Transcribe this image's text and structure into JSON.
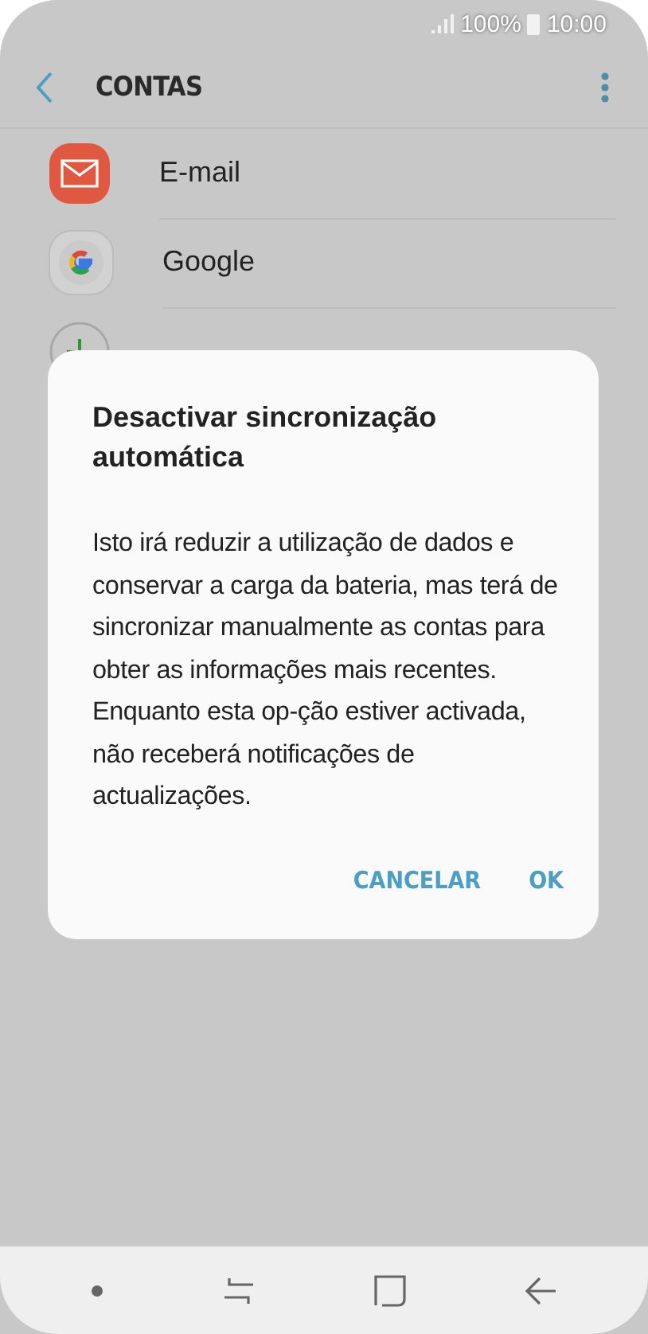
{
  "status_bar": {
    "battery": "100%",
    "time": "10:00"
  },
  "header": {
    "title": "CONTAS"
  },
  "accounts": [
    {
      "kind": "email",
      "label": "E-mail"
    },
    {
      "kind": "google",
      "label": "Google"
    },
    {
      "kind": "add"
    }
  ],
  "dialog": {
    "title": "Desactivar sincronização automática",
    "message": "Isto irá reduzir a utilização de dados e conservar a carga da bateria, mas terá de sincronizar manualmente as contas para obter as informações mais recentes. Enquanto esta op-ção estiver activada, não receberá notificações de actualizações.",
    "buttons": [
      "CANCELAR",
      "OK"
    ]
  }
}
